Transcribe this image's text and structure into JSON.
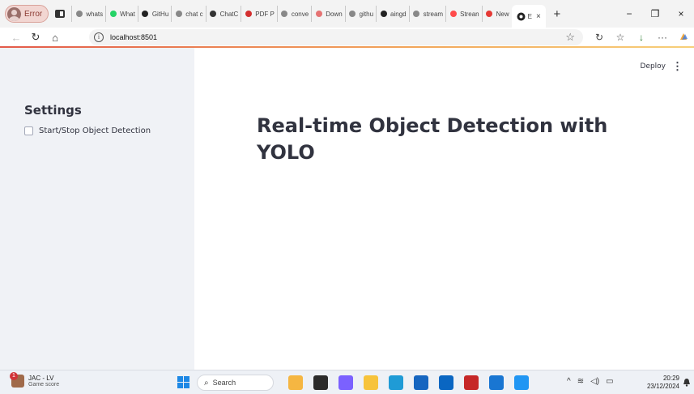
{
  "browser": {
    "profile_label": "Error",
    "tabs": [
      {
        "icon": "search-icon",
        "label": "whats",
        "color": "#888888"
      },
      {
        "icon": "whatsapp-icon",
        "label": "What",
        "color": "#25d366"
      },
      {
        "icon": "github-icon",
        "label": "GitHu",
        "color": "#222222"
      },
      {
        "icon": "search-icon",
        "label": "chat c",
        "color": "#888888"
      },
      {
        "icon": "chatgpt-icon",
        "label": "ChatC",
        "color": "#333333"
      },
      {
        "icon": "pdf-icon",
        "label": "PDF P",
        "color": "#d32f2f"
      },
      {
        "icon": "search-icon",
        "label": "conve",
        "color": "#888888"
      },
      {
        "icon": "download-icon",
        "label": "Down",
        "color": "#e57373"
      },
      {
        "icon": "search-icon",
        "label": "githu",
        "color": "#888888"
      },
      {
        "icon": "github-icon",
        "label": "aingd",
        "color": "#222222"
      },
      {
        "icon": "search-icon",
        "label": "stream",
        "color": "#888888"
      },
      {
        "icon": "streamlit-icon",
        "label": "Strean",
        "color": "#ff4b4b"
      },
      {
        "icon": "new-tab-icon",
        "label": "New",
        "color": "#e53935"
      }
    ],
    "active_tab": {
      "icon": "chrome-tab-icon",
      "label": "E",
      "close": "×"
    },
    "new_tab": "+",
    "window_controls": {
      "minimize": "−",
      "restore": "❐",
      "close": "×"
    },
    "url": "localhost:8501",
    "info_glyph": "i",
    "nav": {
      "back": "←",
      "reload": "↻",
      "home": "⌂"
    },
    "toolbar_icons": {
      "bookmark": "☆",
      "refresh_ext": "↻",
      "favorites": "☆",
      "downloads": "↓",
      "more": "···"
    }
  },
  "app": {
    "sidebar_title": "Settings",
    "checkbox_label": "Start/Stop Object Detection",
    "checkbox_checked": false,
    "deploy_label": "Deploy",
    "menu_glyph": "⋮",
    "heading": "Real-time Object Detection with YOLO"
  },
  "taskbar": {
    "weather_title": "JAC - LV",
    "weather_sub": "Game score",
    "search_label": "Search",
    "search_glyph": "⌕",
    "apps": [
      {
        "name": "people-app-icon",
        "color": "#f5b642"
      },
      {
        "name": "task-view-icon",
        "color": "#2b2b2b"
      },
      {
        "name": "copilot-icon",
        "color": "#7b61ff"
      },
      {
        "name": "file-explorer-icon",
        "color": "#f7c33b"
      },
      {
        "name": "edge-icon",
        "color": "#1f9bd6"
      },
      {
        "name": "store-icon",
        "color": "#1565c0"
      },
      {
        "name": "linkedin-icon",
        "color": "#0a66c2"
      },
      {
        "name": "mcafee-icon",
        "color": "#c62828"
      },
      {
        "name": "outlook-icon",
        "color": "#1976d2"
      },
      {
        "name": "vscode-icon",
        "color": "#2196f3"
      }
    ],
    "tray": {
      "chevron": "^",
      "wifi": "≋",
      "volume": "◁)",
      "battery": "▭"
    },
    "time": "20:29",
    "date": "23/12/2024",
    "bell": "🔔"
  }
}
